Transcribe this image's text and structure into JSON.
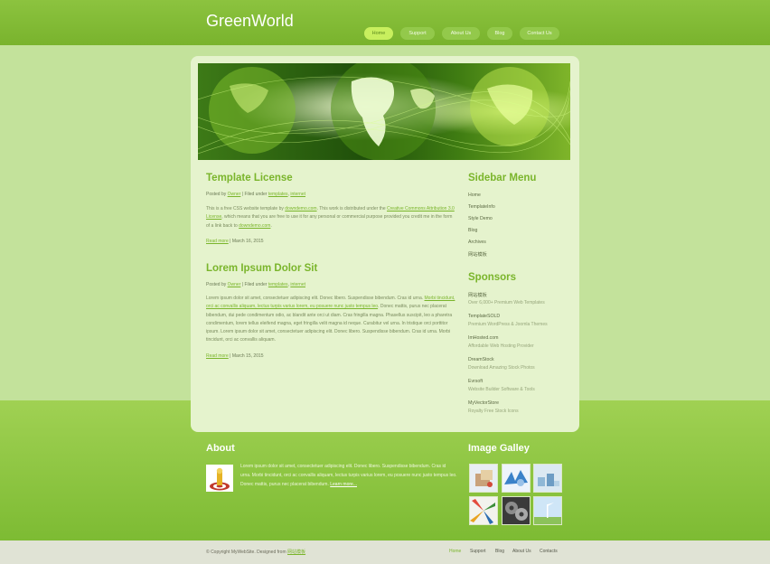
{
  "site": {
    "title": "GreenWorld"
  },
  "nav": {
    "items": [
      "Home",
      "Support",
      "About Us",
      "Blog",
      "Contact Us"
    ]
  },
  "posts": [
    {
      "title": "Template License",
      "meta_prefix": "Posted by",
      "author": "Owner",
      "meta_mid": "| Filed under",
      "cat1": "templates",
      "cat2": "internet",
      "body": [
        {
          "t": "This is a free CSS website template by ",
          "link": false
        },
        {
          "t": "downdemo.com",
          "link": true
        },
        {
          "t": ". This work is distributed under the ",
          "link": false
        },
        {
          "t": "Creative Commons Attribution 3.0 License",
          "link": true
        },
        {
          "t": ", which means that you are free to use it for any personal or commercial purpose provided you credit me in the form of a link back to ",
          "link": false
        },
        {
          "t": "downdemo.com",
          "link": true
        },
        {
          "t": ".",
          "link": false
        }
      ],
      "read_more": "Read more",
      "date": "| March 16, 2015"
    },
    {
      "title": "Lorem Ipsum Dolor Sit",
      "meta_prefix": "Posted by",
      "author": "Owner",
      "meta_mid": "| Filed under",
      "cat1": "templates",
      "cat2": "internet",
      "body": [
        {
          "t": "Lorem ipsum dolor sit amet, consectetuer adipiscing elit. Donec libero. Suspendisse bibendum. Cras id urna. ",
          "link": false
        },
        {
          "t": "Morbi tincidunt, orci ac convallis aliquam, lectus turpis varius lorem, eu posuere nunc justo tempus leo",
          "link": true
        },
        {
          "t": ". Donec mattis, purus nec placerat bibendum, dui pede condimentum odio, ac blandit ante orci ut diam. Cras fringilla magna. Phasellus suscipit, leo a pharetra condimentum, lorem tellus eleifend magna, eget fringilla velit magna id neque. Curabitur vel urna. In tristique orci porttitor ipsum. Lorem ipsum dolor sit amet, consectetuer adipiscing elit. Donec libero. Suspendisse bibendum. Cras id urna. Morbi tincidunt, orci ac convallis aliquam.",
          "link": false
        }
      ],
      "read_more": "Read more",
      "date": "| March 15, 2015"
    }
  ],
  "sidebar": {
    "menu_title": "Sidebar Menu",
    "menu": [
      "Home",
      "TemplateInfo",
      "Style Demo",
      "Blog",
      "Archives",
      "网站模板"
    ],
    "sponsors_title": "Sponsors",
    "sponsors": [
      {
        "name": "网站模板",
        "desc": "Over 6,000+ Premium Web Templates"
      },
      {
        "name": "TemplateSOLD",
        "desc": "Premium WordPress & Joomla Themes"
      },
      {
        "name": "ImHosted.com",
        "desc": "Affordable Web Hosting Provider"
      },
      {
        "name": "DreamStock",
        "desc": "Download Amazing Stock Photos"
      },
      {
        "name": "Evrsoft",
        "desc": "Website Builder Software & Tools"
      },
      {
        "name": "MyVectorStore",
        "desc": "Royalty Free Stock Icons"
      }
    ]
  },
  "about": {
    "title": "About",
    "text": "Lorem ipsum dolor sit amet, consectetuer adipiscing elit. Donec libero. Suspendisse bibendum. Cras id urna. Morbi tincidunt, orci ac convallis aliquam, lectus turpis varius lorem, eu posuere nunc justo tempus leo. Donec mattis, purus nec placerat bibendum.",
    "more": "Learn more..."
  },
  "gallery": {
    "title": "Image Galley"
  },
  "footer": {
    "copyright": "© Copyright MyWebSite. Designed from",
    "designer": "网站模板",
    "links": [
      "Home",
      "Support",
      "Blog",
      "About Us",
      "Contacts"
    ]
  },
  "colors": {
    "accent": "#7ab52b",
    "header": "#80b935",
    "content_bg": "#e5f3cd"
  }
}
